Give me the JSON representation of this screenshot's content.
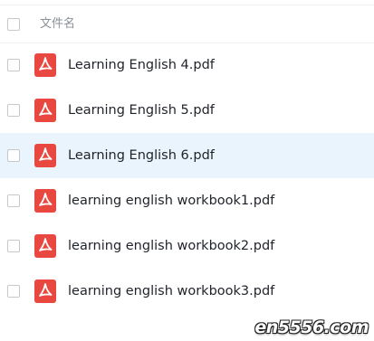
{
  "header": {
    "column_label": "文件名"
  },
  "files": [
    {
      "name": "Learning English 4.pdf",
      "selected": false,
      "icon": "pdf-icon"
    },
    {
      "name": "Learning English 5.pdf",
      "selected": false,
      "icon": "pdf-icon"
    },
    {
      "name": "Learning English 6.pdf",
      "selected": true,
      "icon": "pdf-icon"
    },
    {
      "name": "learning english workbook1.pdf",
      "selected": false,
      "icon": "pdf-icon"
    },
    {
      "name": "learning english workbook2.pdf",
      "selected": false,
      "icon": "pdf-icon"
    },
    {
      "name": "learning english workbook3.pdf",
      "selected": false,
      "icon": "pdf-icon"
    }
  ],
  "colors": {
    "pdf_icon": "#e8483f",
    "selected_row": "#eaf4fc",
    "text": "#1f2329",
    "header_text": "#8a8f98"
  },
  "watermark": "en5556.com"
}
